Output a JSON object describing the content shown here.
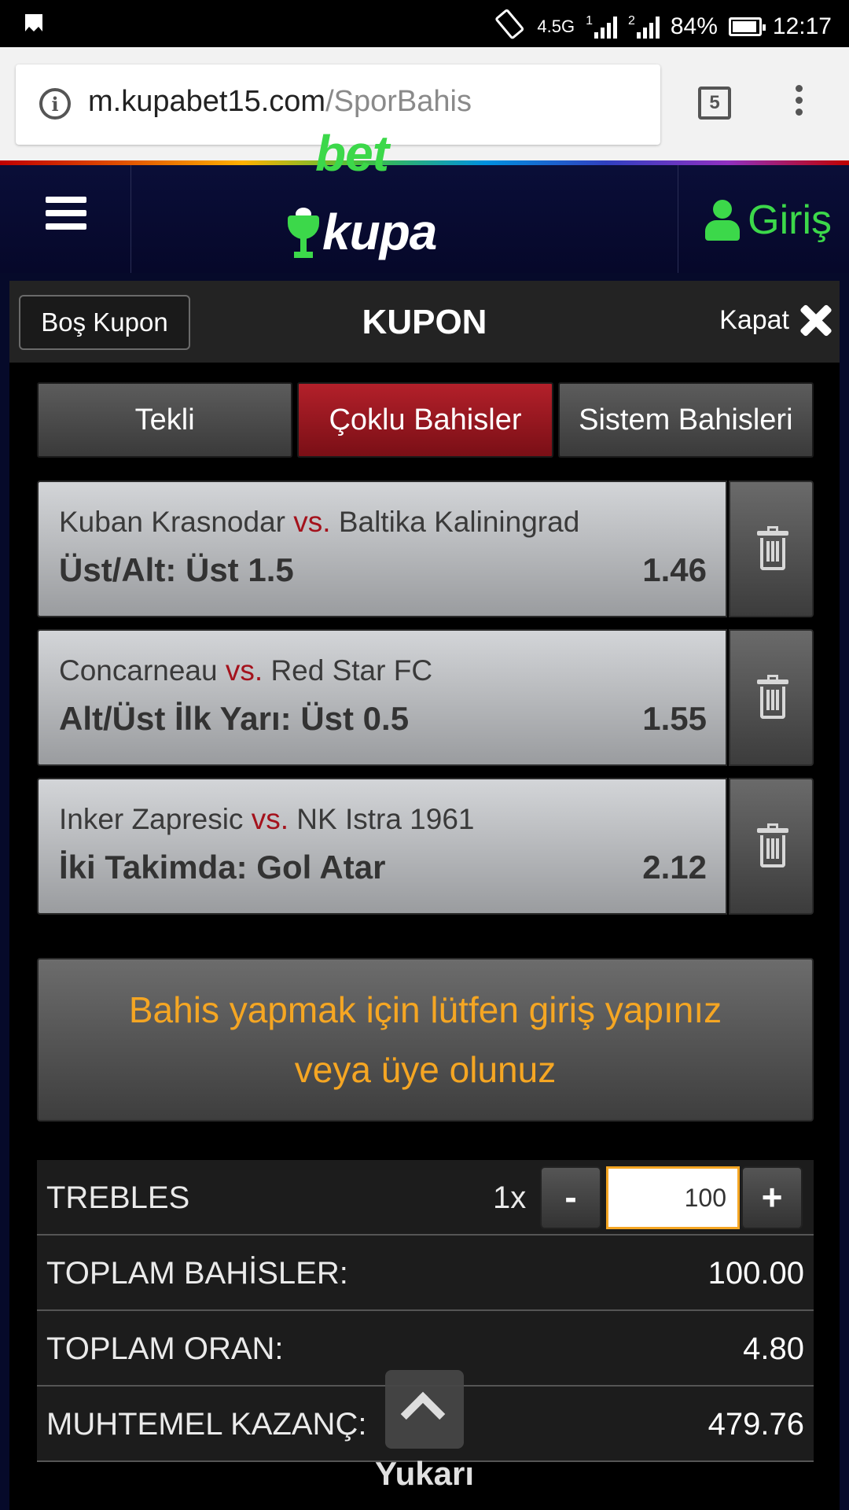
{
  "status_bar": {
    "network": "4.5G",
    "sim1": "1",
    "sim2": "2",
    "battery": "84%",
    "battery_level": 0.84,
    "time": "12:17"
  },
  "browser": {
    "url_host": "m.kupabet15.com",
    "url_path": "/SporBahis",
    "tab_count": "5"
  },
  "header": {
    "logo_part1": "kupa",
    "logo_part2": "bet",
    "login_label": "Giriş"
  },
  "kupon": {
    "clear_button": "Boş Kupon",
    "title": "KUPON",
    "close_label": "Kapat",
    "tabs": [
      {
        "label": "Tekli",
        "active": false
      },
      {
        "label": "Çoklu Bahisler",
        "active": true
      },
      {
        "label": "Sistem Bahisleri",
        "active": false
      }
    ],
    "vs": "vs.",
    "bets": [
      {
        "home": "Kuban Krasnodar",
        "away": "Baltika Kaliningrad",
        "market": "Üst/Alt: Üst 1.5",
        "odd": "1.46"
      },
      {
        "home": "Concarneau",
        "away": "Red Star FC",
        "market": "Alt/Üst İlk Yarı: Üst 0.5",
        "odd": "1.55"
      },
      {
        "home": "Inker Zapresic",
        "away": "NK Istra 1961",
        "market": "İki Takimda: Gol Atar",
        "odd": "2.12"
      }
    ],
    "login_message_line1": "Bahis yapmak için lütfen giriş yapınız",
    "login_message_line2": "veya üye olunuz",
    "summary": {
      "trebles_label": "TREBLES",
      "multiplier": "1x",
      "minus": "-",
      "plus": "+",
      "stake": "100",
      "total_bets_label": "TOPLAM BAHİSLER:",
      "total_bets_value": "100.00",
      "total_odds_label": "TOPLAM ORAN:",
      "total_odds_value": "4.80",
      "potential_win_label": "MUHTEMEL KAZANÇ:",
      "potential_win_value": "479.76"
    }
  },
  "scroll_top_label": "Yukarı",
  "colors": {
    "accent_green": "#3cd84a",
    "active_tab_red": "#b3202a",
    "message_orange": "#f5a623",
    "vs_red": "#a4121c"
  }
}
